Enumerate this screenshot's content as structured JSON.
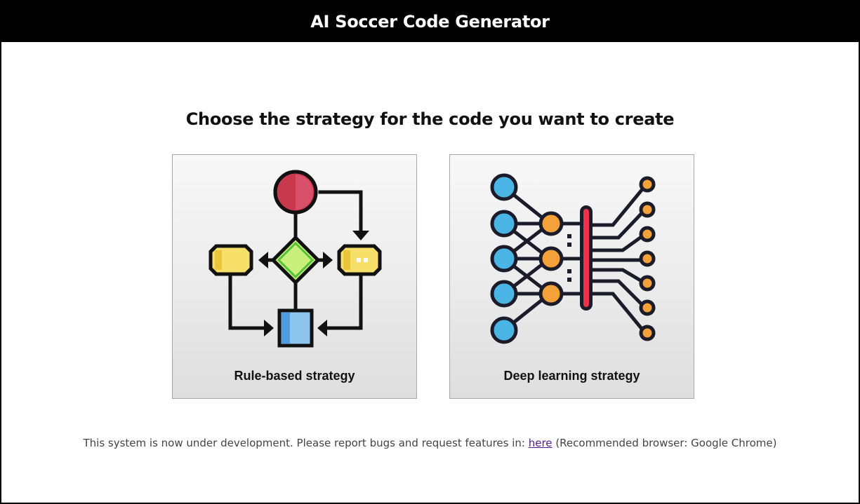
{
  "header": {
    "title": "AI Soccer Code Generator"
  },
  "main": {
    "heading": "Choose the strategy for the code you want to create",
    "cards": [
      {
        "label": "Rule-based strategy",
        "icon": "flowchart-icon"
      },
      {
        "label": "Deep learning strategy",
        "icon": "neural-network-icon"
      }
    ]
  },
  "footer": {
    "text_before": "This system is now under development. Please report bugs and request features in: ",
    "link_text": "here",
    "text_after": " (Recommended browser: Google Chrome)"
  },
  "colors": {
    "header_bg": "#000000",
    "link": "#551a8b",
    "flow_circle": "#c8394e",
    "flow_diamond": "#c8f07a",
    "flow_box_yellow": "#f2d94e",
    "flow_square_blue": "#8ec5ee",
    "nn_input": "#4bb6e6",
    "nn_hidden": "#f5a13a",
    "nn_bar": "#e9334a"
  }
}
